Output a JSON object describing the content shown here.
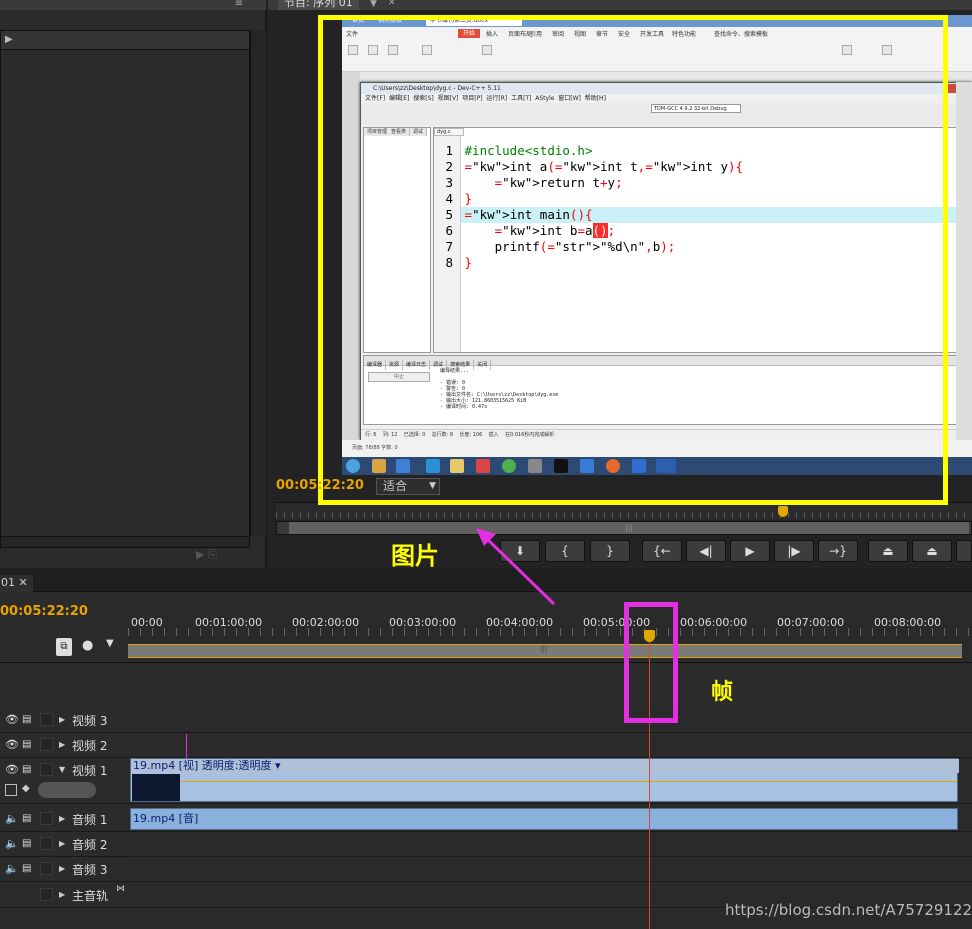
{
  "program_monitor": {
    "tab_label": "节目: 序列 01",
    "timecode": "00:05:22:20",
    "fit_option": "适合"
  },
  "screen": {
    "tabs": [
      "首页",
      "稻壳模板",
      "季节赠刊第三页.docx"
    ],
    "ribbon_menu": [
      "文件",
      "开始",
      "插入",
      "页面布局",
      "引用",
      "审阅",
      "视图",
      "章节",
      "安全",
      "开发工具",
      "特色功能",
      "查找命令、搜索模板"
    ],
    "devcpp": {
      "title": "C:\\Users\\zz\\Desktop\\dyg.c - Dev-C++ 5.11",
      "menu": [
        "文件[F]",
        "编辑[E]",
        "搜索[S]",
        "视图[V]",
        "项目[P]",
        "运行[R]",
        "工具[T]",
        "AStyle",
        "窗口[W]",
        "帮助[H]"
      ],
      "compiler": "TDM-GCC 4.9.2 32-bit Debug",
      "left_tabs": [
        "项目管理",
        "查看类",
        "调试"
      ],
      "file_tab": "dyg.c",
      "code_lines": [
        {
          "n": "1",
          "text": "#include<stdio.h>"
        },
        {
          "n": "2",
          "text": "int a(int t,int y){"
        },
        {
          "n": "3",
          "text": "    return t+y;"
        },
        {
          "n": "4",
          "text": "}"
        },
        {
          "n": "5",
          "text": "int main(){"
        },
        {
          "n": "6",
          "text": "    int b=a();"
        },
        {
          "n": "7",
          "text": "    printf(\"%d\\n\",b);"
        },
        {
          "n": "8",
          "text": "}"
        }
      ],
      "bottom_tabs": [
        "编译器",
        "资源",
        "编译日志",
        "调试",
        "搜索结果",
        "关闭"
      ],
      "stop_button": "中止",
      "output": "编译结果...\n\n- 错误: 0\n- 警告: 0\n- 输出文件名: C:\\Users\\zz\\Desktop\\dyg.exe\n- 输出大小: 121.8603515625 KiB\n- 编译时间: 0.47s",
      "status": "行: 6    列: 12    已选择: 0    总行数: 8    长度: 106    插入    在0.016秒内完成解析"
    },
    "wps_status": "页面: 78/88   字数: 0"
  },
  "timeline": {
    "tab_label": "01",
    "timecode": "00:05:22:20",
    "ruler_labels": [
      "00:00",
      "00:01:00:00",
      "00:02:00:00",
      "00:03:00:00",
      "00:04:00:00",
      "00:05:00:00",
      "00:06:00:00",
      "00:07:00:00",
      "00:08:00:00"
    ],
    "tracks": [
      "视频 3",
      "视频 2",
      "视频 1",
      "音频 1",
      "音频 2",
      "音频 3",
      "主音轨"
    ],
    "video_clip_label": "19.mp4 [视] 透明度:透明度 ▾",
    "audio_clip_label": "19.mp4 [音]"
  },
  "annotations": {
    "picture_label": "图片",
    "frame_label": "帧",
    "highlight_color": "#ffff00",
    "magenta_color": "#e22fe2"
  },
  "watermark": "https://blog.csdn.net/A757291228"
}
